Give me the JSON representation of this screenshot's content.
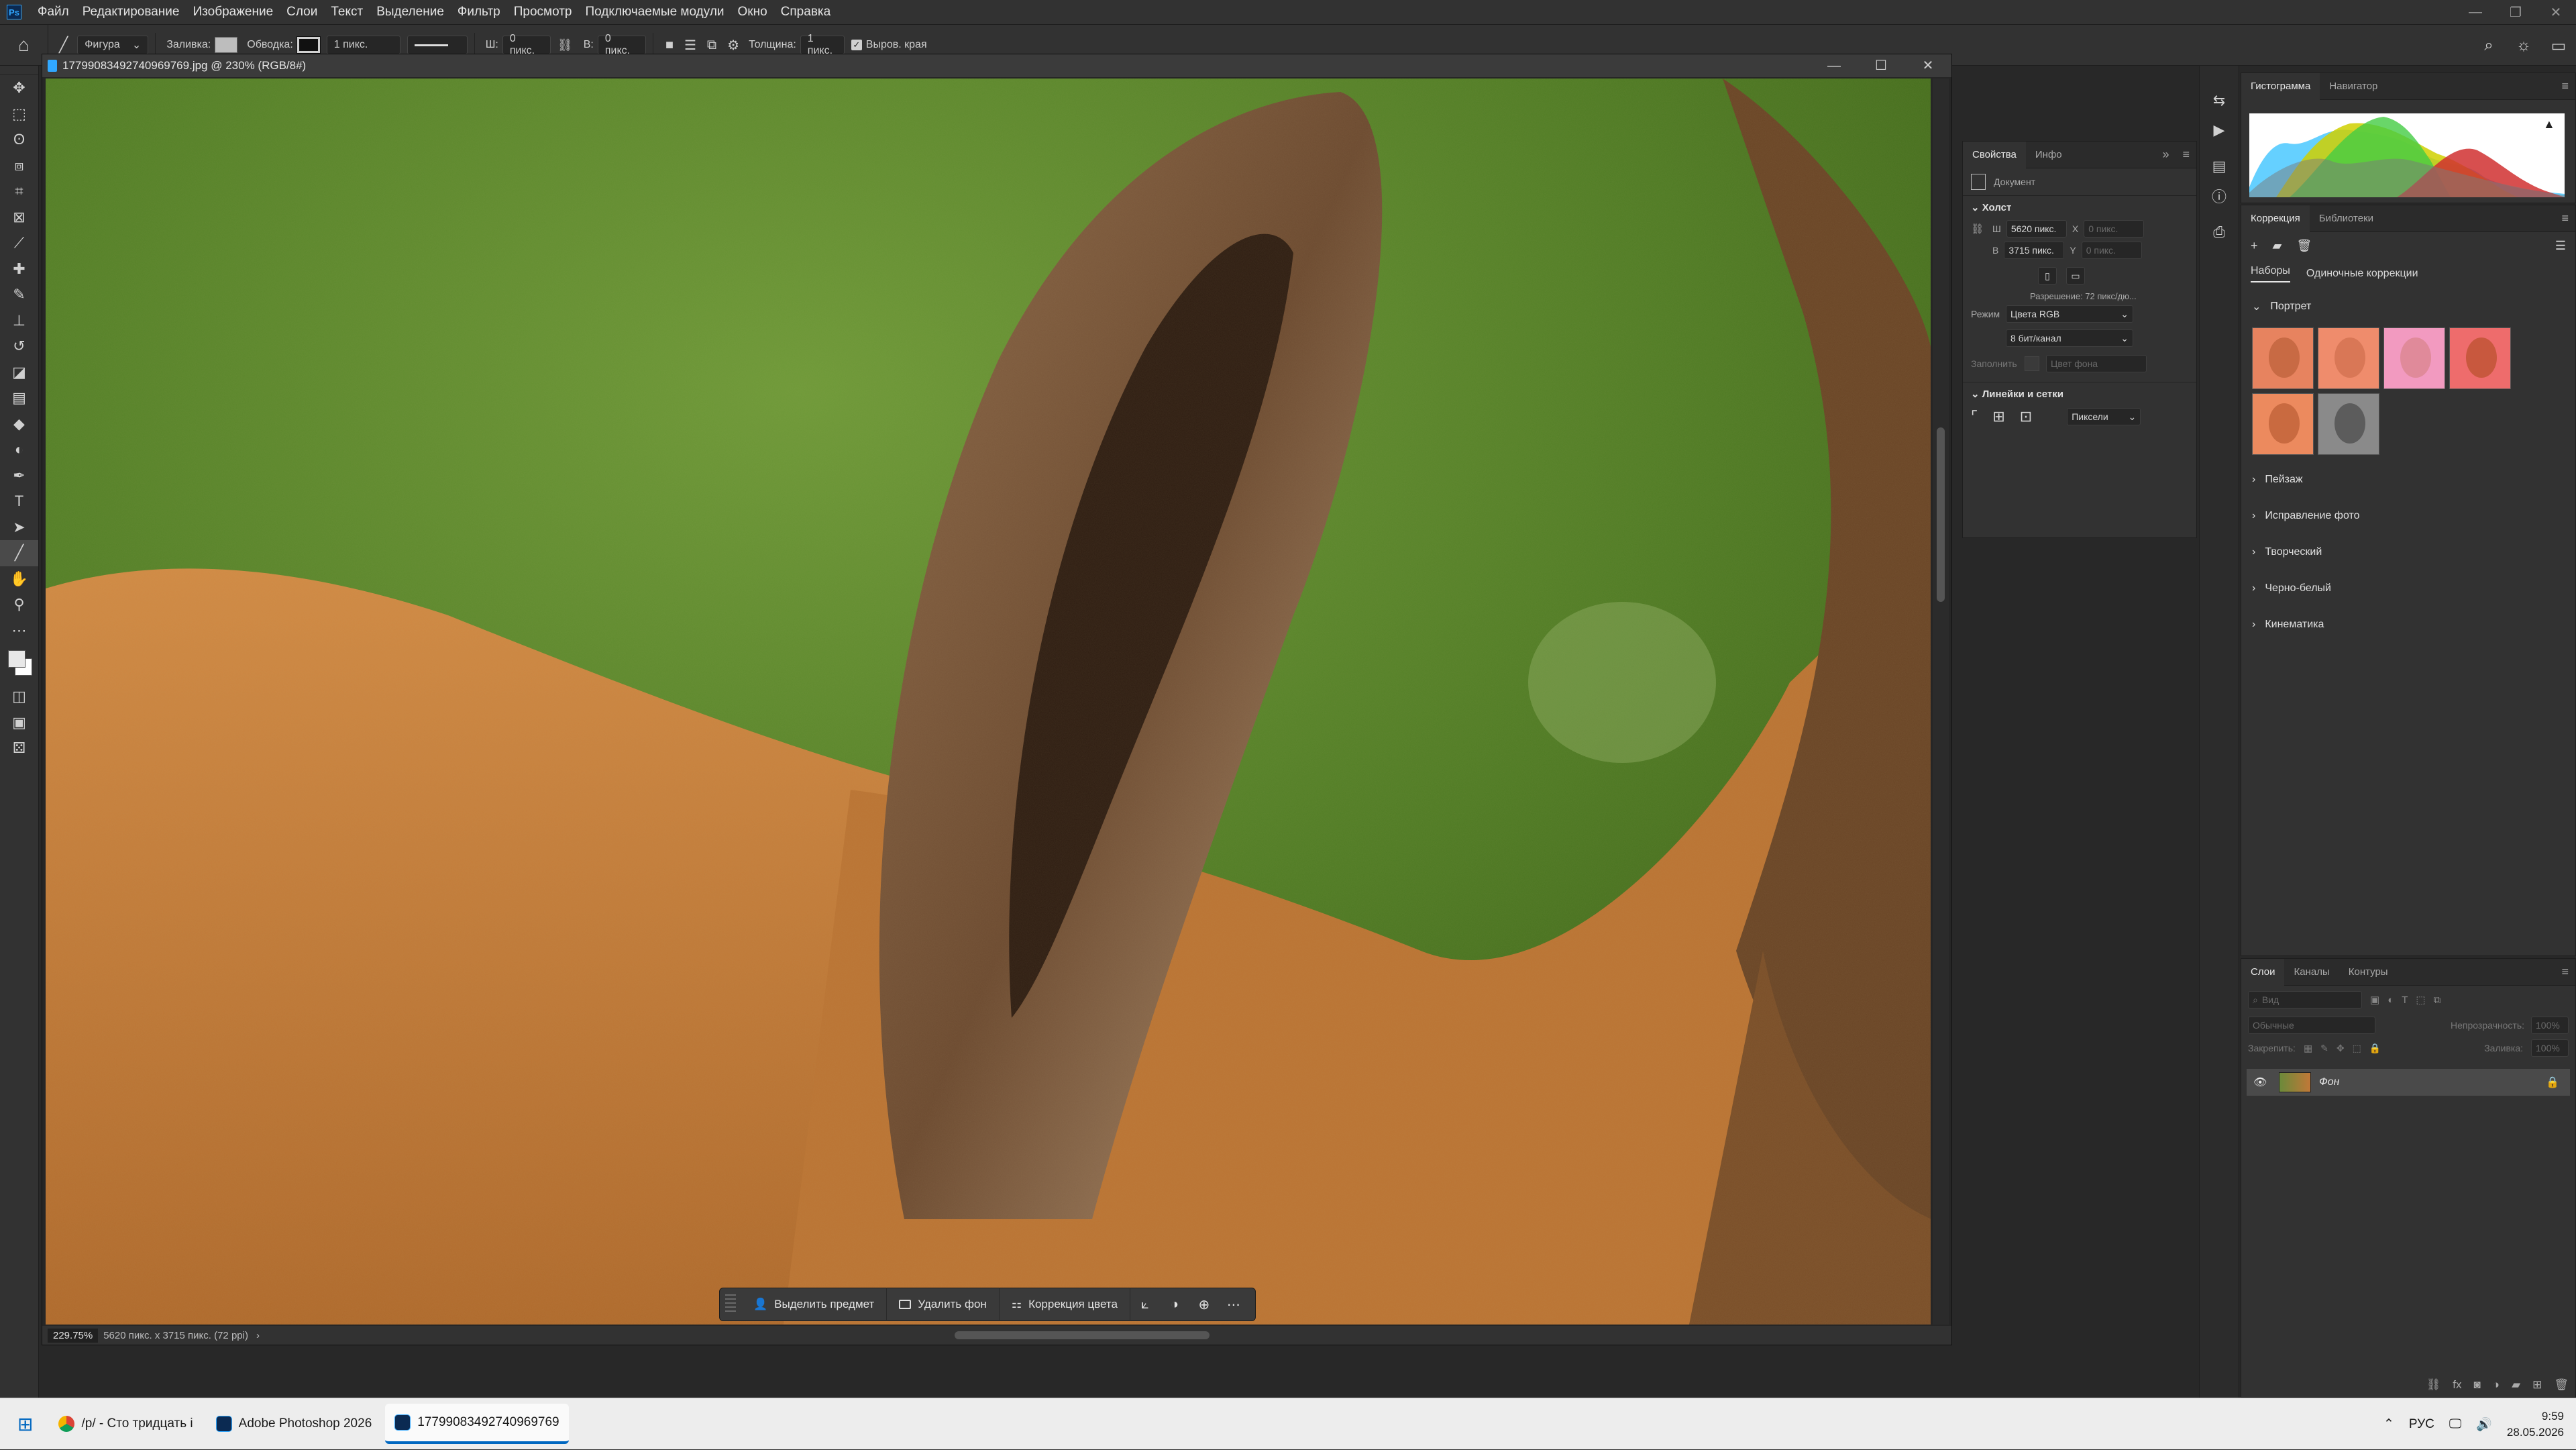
{
  "app": {
    "logo": "Ps"
  },
  "menubar": {
    "items": [
      "Файл",
      "Редактирование",
      "Изображение",
      "Слои",
      "Текст",
      "Выделение",
      "Фильтр",
      "Просмотр",
      "Подключаемые модули",
      "Окно",
      "Справка"
    ],
    "window_buttons": [
      "minimize-icon",
      "restore-icon",
      "close-icon"
    ]
  },
  "options_bar": {
    "tool_icon": "line-tool-icon",
    "mode": "Фигура",
    "fill_label": "Заливка:",
    "stroke_label": "Обводка:",
    "stroke_width": "1 пикс.",
    "w_label": "Ш:",
    "w_value": "0 пикс.",
    "link_icon": "link-icon",
    "h_label": "В:",
    "h_value": "0 пикс.",
    "thickness_label": "Толщина:",
    "thickness_value": "1 пикс.",
    "align_edges_label": "Выров. края",
    "align_edges_checked": true,
    "right_icons": [
      "search-icon",
      "bulb-icon",
      "workspace-icon"
    ]
  },
  "toolbar": {
    "tools": [
      "move-tool-icon",
      "marquee-tool-icon",
      "lasso-tool-icon",
      "object-select-tool-icon",
      "crop-tool-icon",
      "frame-tool-icon",
      "eyedropper-tool-icon",
      "healing-brush-icon",
      "brush-tool-icon",
      "clone-stamp-icon",
      "history-brush-icon",
      "eraser-tool-icon",
      "gradient-tool-icon",
      "blur-tool-icon",
      "dodge-tool-icon",
      "pen-tool-icon",
      "type-tool-icon",
      "path-select-icon",
      "line-tool-icon",
      "hand-tool-icon",
      "zoom-tool-icon",
      "more-tools-icon"
    ],
    "active_tool": "line-tool-icon"
  },
  "document": {
    "title": "17799083492740969769.jpg @ 230% (RGB/8#)",
    "zoom": "229.75%",
    "size_info": "5620 пикс. x 3715 пикс. (72 ppi)"
  },
  "context_bar": {
    "select_subject": "Выделить предмет",
    "remove_bg": "Удалить фон",
    "color_correction": "Коррекция цвета"
  },
  "properties": {
    "tabs": [
      "Свойства",
      "Инфо"
    ],
    "doc_label": "Документ",
    "canvas_section": "Холст",
    "w_label": "Ш",
    "w_value": "5620 пикс.",
    "x_label": "X",
    "x_placeholder": "0 пикс.",
    "h_label": "В",
    "h_value": "3715 пикс.",
    "y_label": "Y",
    "y_placeholder": "0 пикс.",
    "resolution": "Разрешение: 72 пикс/дю...",
    "mode_label": "Режим",
    "mode_value": "Цвета RGB",
    "depth_value": "8 бит/канал",
    "fill_label": "Заполнить",
    "fill_value": "Цвет фона",
    "guides_section": "Линейки и сетки",
    "units_value": "Пиксели"
  },
  "histogram_panel": {
    "tabs": [
      "Гистограмма",
      "Навигатор"
    ]
  },
  "corrections_panel": {
    "tabs": [
      "Коррекция",
      "Библиотеки"
    ],
    "subtabs": [
      "Наборы",
      "Одиночные коррекции"
    ],
    "groups": [
      "Портрет",
      "Пейзаж",
      "Исправление фото",
      "Творческий",
      "Черно-белый",
      "Кинематика"
    ]
  },
  "layers_panel": {
    "tabs": [
      "Слои",
      "Каналы",
      "Контуры"
    ],
    "search_placeholder": "Вид",
    "blend_mode": "Обычные",
    "opacity_label": "Непрозрачность:",
    "opacity_value": "100%",
    "lock_label": "Закрепить:",
    "fill_label": "Заливка:",
    "fill_value": "100%",
    "layer_name": "Фон"
  },
  "taskbar": {
    "apps": [
      {
        "label": "/р/ - Сто тридцать і",
        "icon": "chrome-icon"
      },
      {
        "label": "Adobe Photoshop 2026",
        "icon": "photoshop-icon"
      },
      {
        "label": "17799083492740969769",
        "icon": "photoshop-doc-icon"
      }
    ],
    "lang": "РУС",
    "time": "9:59",
    "date": "28.05.2026"
  },
  "colors": {
    "ui_bg": "#323232",
    "accent": "#31a8ff",
    "fur": "#c07838",
    "grass": "#5e8a2a"
  }
}
